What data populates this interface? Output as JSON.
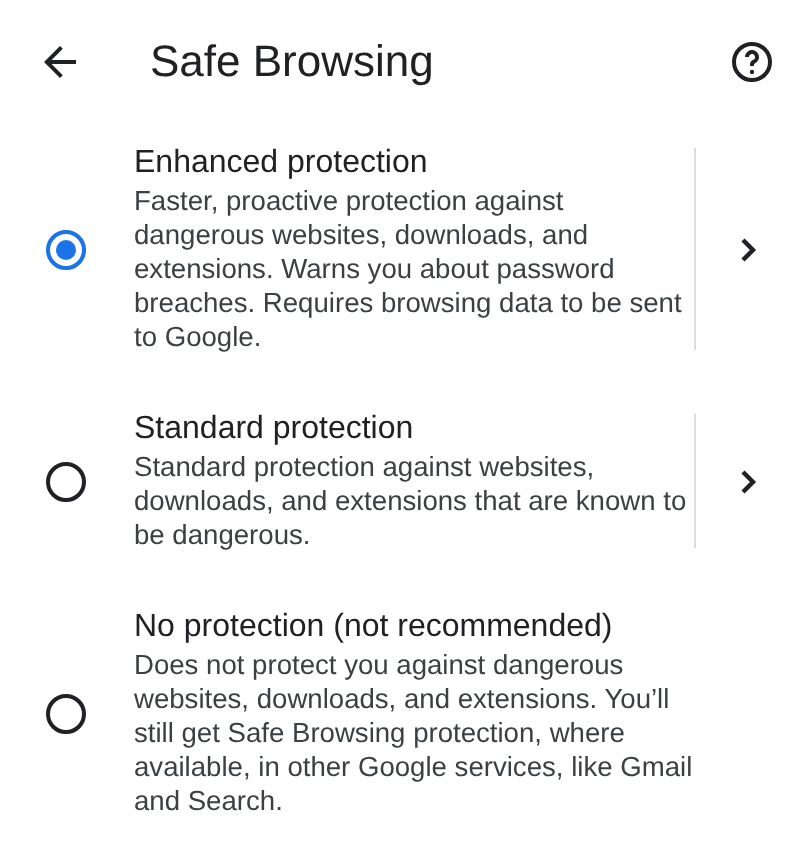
{
  "header": {
    "title": "Safe Browsing"
  },
  "options": [
    {
      "title": "Enhanced protection",
      "description": "Faster, proactive protection against dangerous websites, downloads, and extensions. Warns you about password breaches. Requires browsing data to be sent to Google.",
      "selected": true,
      "has_details": true
    },
    {
      "title": "Standard protection",
      "description": "Standard protection against websites, downloads, and extensions that are known to be dangerous.",
      "selected": false,
      "has_details": true
    },
    {
      "title": "No protection (not recommended)",
      "description": "Does not protect you against dangerous websites, downloads, and extensions. You’ll still get Safe Browsing protection, where available, in other Google services, like Gmail and Search.",
      "selected": false,
      "has_details": false
    }
  ]
}
